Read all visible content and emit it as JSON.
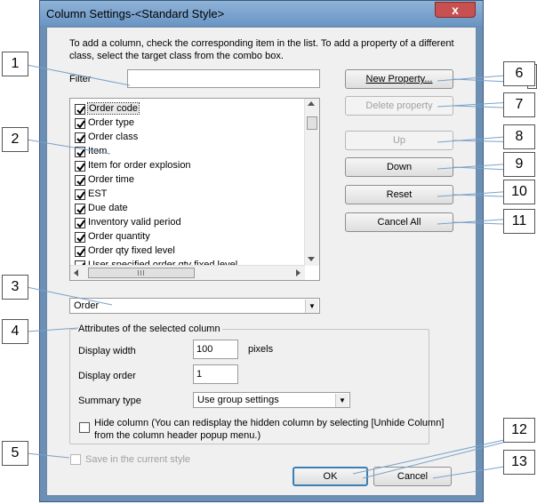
{
  "window": {
    "title": "Column Settings-<Standard Style>",
    "close_glyph": "x"
  },
  "instructions": "To add a column, check the corresponding item in the list. To add a property of a different class, select the target class from the combo box.",
  "filter": {
    "label": "Filter",
    "value": ""
  },
  "columns_list": {
    "items": [
      {
        "label": "Order code",
        "checked": true
      },
      {
        "label": "Order type",
        "checked": true
      },
      {
        "label": "Order class",
        "checked": true
      },
      {
        "label": "Item",
        "checked": true
      },
      {
        "label": "Item for order explosion",
        "checked": true
      },
      {
        "label": "Order time",
        "checked": true
      },
      {
        "label": "EST",
        "checked": true
      },
      {
        "label": "Due date",
        "checked": true
      },
      {
        "label": "Inventory valid period",
        "checked": true
      },
      {
        "label": "Order quantity",
        "checked": true
      },
      {
        "label": "Order qty fixed level",
        "checked": true
      },
      {
        "label": "User specified order qty fixed level",
        "checked": true
      }
    ]
  },
  "class_combo": {
    "value": "Order"
  },
  "attributes": {
    "group_label": "Attributes of the selected column",
    "display_width_label": "Display width",
    "display_width_value": "100",
    "pixels_label": "pixels",
    "display_order_label": "Display order",
    "display_order_value": "1",
    "summary_type_label": "Summary type",
    "summary_type_value": "Use group settings",
    "hide_column_text_1": "Hide column (You can redisplay the hidden column by selecting [Unhide Column]",
    "hide_column_text_2": "from the column header popup menu.)"
  },
  "save_in_style_label": "Save in the current style",
  "buttons": {
    "new_property": "New Property...",
    "delete_property": "Delete property",
    "up": "Up",
    "down": "Down",
    "reset": "Reset",
    "cancel_all": "Cancel All",
    "ok": "OK",
    "cancel": "Cancel"
  },
  "callouts": [
    "1",
    "2",
    "3",
    "4",
    "5",
    "6",
    "7",
    "8",
    "9",
    "10",
    "11",
    "12",
    "13"
  ]
}
